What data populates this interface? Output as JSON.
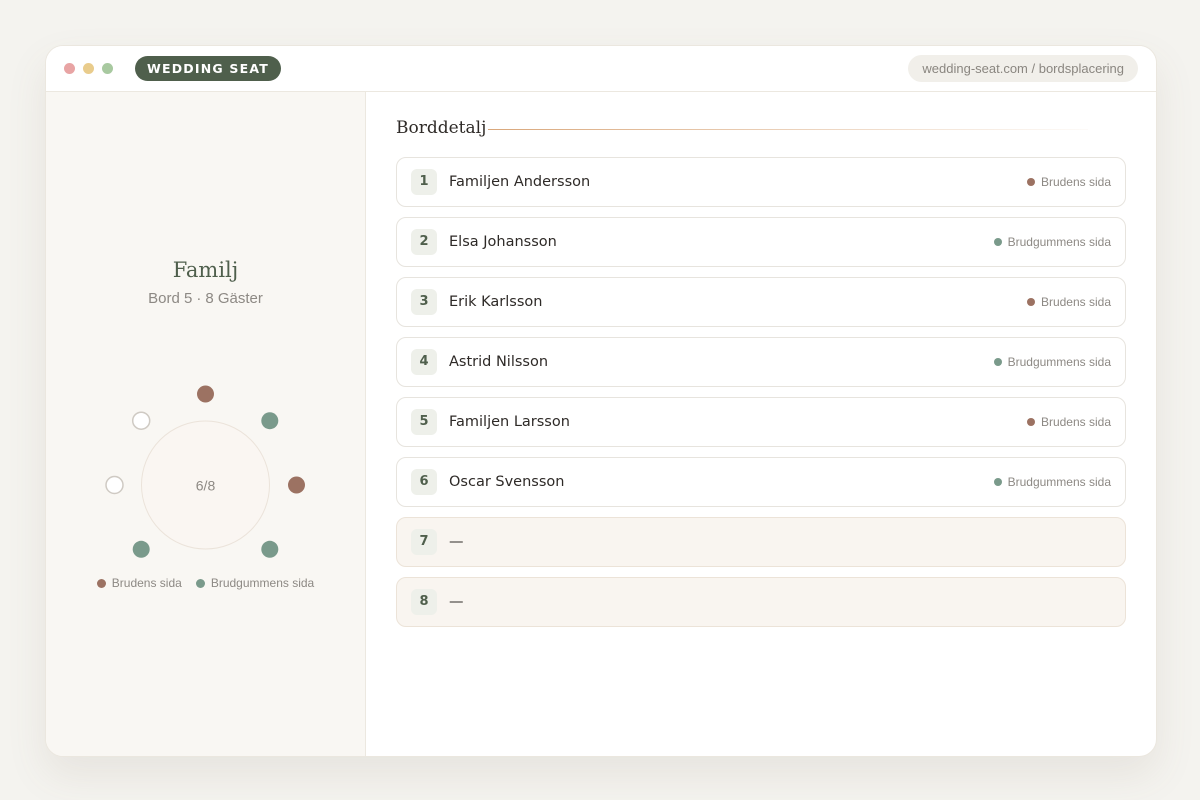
{
  "app": {
    "brand": "WEDDING SEAT",
    "url": "wedding-seat.com / bordsplacering"
  },
  "colors": {
    "bride": "#9c7262",
    "groom": "#7a9a8b",
    "brand": "#4f5f4c",
    "accent_line": "#d9a77b"
  },
  "table": {
    "name": "Familj",
    "number_text": "Bord 5",
    "separator": "·",
    "guests_text": "8 Gäster",
    "occupancy": "6/8",
    "seats": [
      "bride",
      "groom",
      "bride",
      "groom",
      "bride",
      "groom",
      "empty",
      "empty"
    ]
  },
  "legend": {
    "bride_label": "Brudens sida",
    "groom_label": "Brudgummens sida"
  },
  "detail": {
    "title": "Borddetalj",
    "guests": [
      {
        "number": "1",
        "name": "Familjen Andersson",
        "side": "bride",
        "side_label": "Brudens sida"
      },
      {
        "number": "2",
        "name": "Elsa Johansson",
        "side": "groom",
        "side_label": "Brudgummens sida"
      },
      {
        "number": "3",
        "name": "Erik Karlsson",
        "side": "bride",
        "side_label": "Brudens sida"
      },
      {
        "number": "4",
        "name": "Astrid Nilsson",
        "side": "groom",
        "side_label": "Brudgummens sida"
      },
      {
        "number": "5",
        "name": "Familjen Larsson",
        "side": "bride",
        "side_label": "Brudens sida"
      },
      {
        "number": "6",
        "name": "Oscar Svensson",
        "side": "groom",
        "side_label": "Brudgummens sida"
      },
      {
        "number": "7",
        "name": "—",
        "side": "empty",
        "side_label": ""
      },
      {
        "number": "8",
        "name": "—",
        "side": "empty",
        "side_label": ""
      }
    ]
  }
}
